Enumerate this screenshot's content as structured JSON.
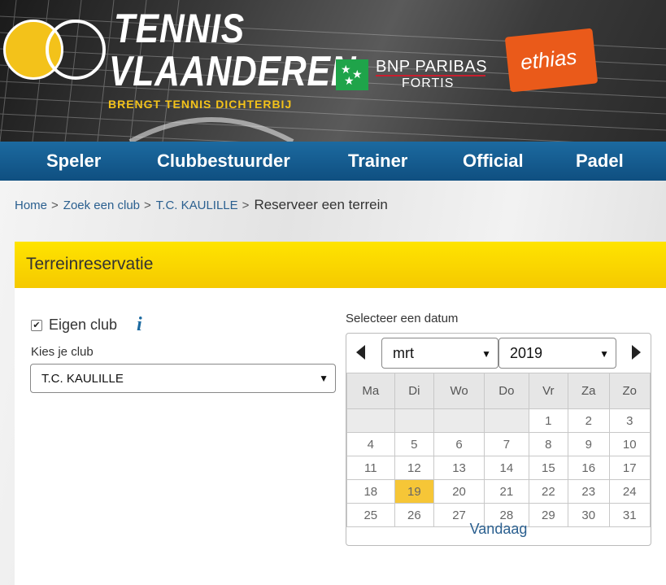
{
  "header": {
    "brand_line1": "TENNIS",
    "brand_line2": "VLAANDEREN",
    "tagline": "BRENGT TENNIS DICHTERBIJ",
    "sponsor1_line1": "BNP PARIBAS",
    "sponsor1_line2": "FORTIS",
    "sponsor2": "ethias"
  },
  "colors": {
    "nav": "#1c6aa0",
    "accent_yellow": "#ffe400",
    "today_highlight": "#f6c637",
    "link": "#2a5f8f"
  },
  "nav": {
    "items": [
      "Speler",
      "Clubbestuurder",
      "Trainer",
      "Official",
      "Padel"
    ]
  },
  "breadcrumb": {
    "items": [
      "Home",
      "Zoek een club",
      "T.C. KAULILLE"
    ],
    "current": "Reserveer een terrein",
    "separator": ">"
  },
  "panel": {
    "title": "Terreinreservatie",
    "own_club_label": "Eigen club",
    "own_club_checked": true,
    "info_icon": "info-icon",
    "club_label": "Kies je club",
    "club_value": "T.C. KAULILLE"
  },
  "calendar": {
    "label": "Selecteer een datum",
    "month": "mrt",
    "year": "2019",
    "weekdays": [
      "Ma",
      "Di",
      "Wo",
      "Do",
      "Vr",
      "Za",
      "Zo"
    ],
    "weeks": [
      [
        "",
        "",
        "",
        "",
        "1",
        "2",
        "3"
      ],
      [
        "4",
        "5",
        "6",
        "7",
        "8",
        "9",
        "10"
      ],
      [
        "11",
        "12",
        "13",
        "14",
        "15",
        "16",
        "17"
      ],
      [
        "18",
        "19",
        "20",
        "21",
        "22",
        "23",
        "24"
      ],
      [
        "25",
        "26",
        "27",
        "28",
        "29",
        "30",
        "31"
      ]
    ],
    "selected_day": "19",
    "today_label": "Vandaag"
  }
}
